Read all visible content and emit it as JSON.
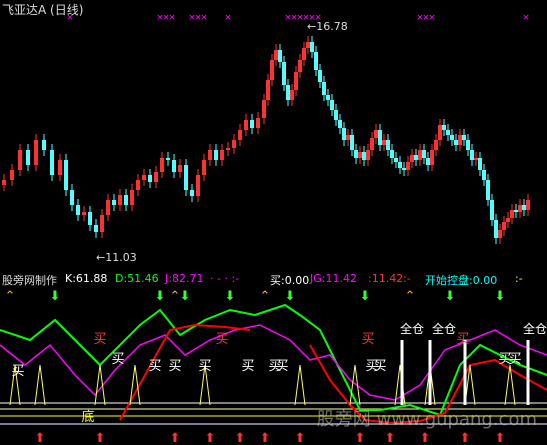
{
  "upper": {
    "title": "飞亚达A (日线)",
    "high_label": "16.78",
    "low_label": "11.03"
  },
  "indicator": {
    "name": "股旁网制作",
    "k": "K:61.88",
    "d": "D:51.46",
    "j": "J:82.71",
    "dash1": "·  - · :-",
    "buy": "买:0.00",
    "jg": "JG:11.42",
    "colon_value": ":11.42",
    "dash2": ":-",
    "open_control": "开始控盘:0.00",
    "dash3": ":-"
  },
  "lower": {
    "signals_buy_red": [
      "买",
      "买",
      "买",
      "买"
    ],
    "signals_buy_white": [
      "买",
      "买",
      "买",
      "买",
      "买",
      "买",
      "买",
      "买",
      "买",
      "买",
      "买",
      "买"
    ],
    "full_position": [
      "全仓",
      "全仓",
      "全仓"
    ],
    "bottom_label": "底"
  },
  "watermark": "股旁网 www.gupang.com",
  "colors": {
    "up_candle": "#ff3232",
    "down_candle": "#54ffff",
    "magenta": "#ff00ff",
    "k_line": "#ffffff",
    "d_line": "#ffff00",
    "j_line": "#ff00ff",
    "green_line": "#00ff00",
    "red_line": "#ff0000"
  }
}
